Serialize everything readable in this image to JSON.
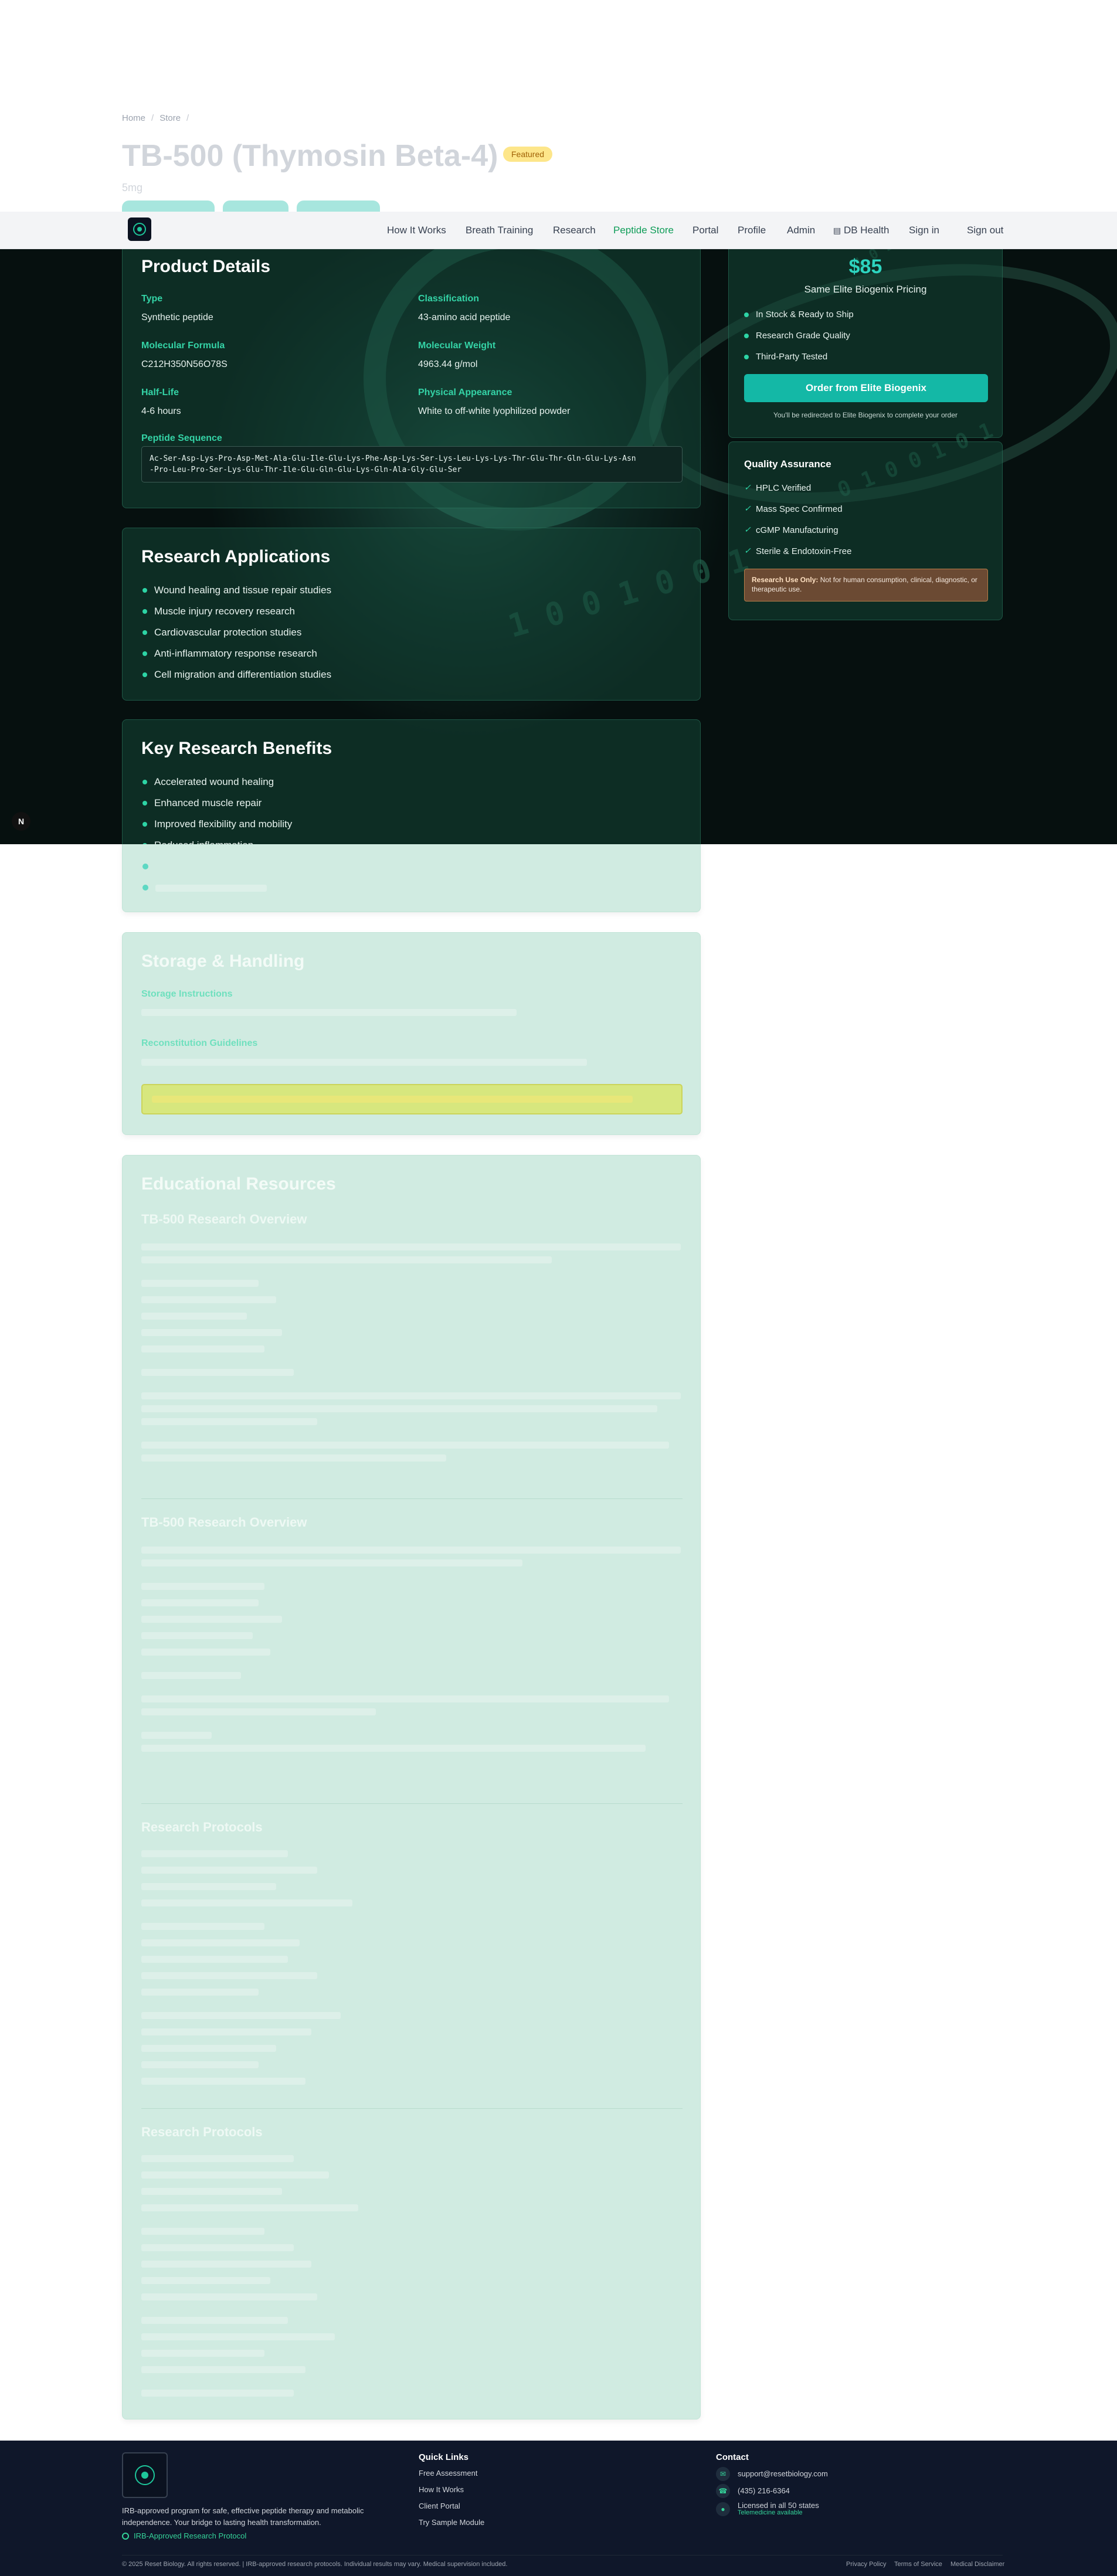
{
  "breadcrumb": {
    "home": "Home",
    "sep": "/",
    "store": "Store",
    "sep2": "/"
  },
  "page": {
    "title": "TB-500 (Thymosin Beta-4)",
    "badge": "Featured",
    "subtitle": "5mg"
  },
  "nav": {
    "items": [
      "How It Works",
      "Breath Training",
      "Research",
      "Peptide Store",
      "Portal",
      "Profile",
      "Admin",
      "DB Health",
      "Sign in",
      "Sign out"
    ],
    "active": "Peptide Store"
  },
  "product_details": {
    "title": "Product Details",
    "type_label": "Type",
    "type_value": "Synthetic peptide",
    "class_label": "Classification",
    "class_value": "43-amino acid peptide",
    "formula_label": "Molecular Formula",
    "formula_value": "C212H350N56O78S",
    "weight_label": "Molecular Weight",
    "weight_value": "4963.44 g/mol",
    "halflife_label": "Half-Life",
    "halflife_value": "4-6 hours",
    "appearance_label": "Physical Appearance",
    "appearance_value": "White to off-white lyophilized powder",
    "sequence_label": "Peptide Sequence",
    "sequence_line1": "Ac-Ser-Asp-Lys-Pro-Asp-Met-Ala-Glu-Ile-Glu-Lys-Phe-Asp-Lys-Ser-Lys-Leu-Lys-Lys-Thr-Glu-Thr-Gln-Glu-Lys-Asn",
    "sequence_line2": "-Pro-Leu-Pro-Ser-Lys-Glu-Thr-Ile-Glu-Gln-Glu-Lys-Gln-Ala-Gly-Glu-Ser"
  },
  "research_applications": {
    "title": "Research Applications",
    "items": [
      "Wound healing and tissue repair studies",
      "Muscle injury recovery research",
      "Cardiovascular protection studies",
      "Anti-inflammatory response research",
      "Cell migration and differentiation studies"
    ]
  },
  "key_benefits": {
    "title": "Key Research Benefits",
    "items": [
      "Accelerated wound healing",
      "Enhanced muscle repair",
      "Improved flexibility and mobility",
      "Reduced inflammation"
    ]
  },
  "storage": {
    "title": "Storage & Handling",
    "storage_label": "Storage Instructions",
    "recon_label": "Reconstitution Guidelines"
  },
  "education": {
    "title": "Educational Resources",
    "overview1": "TB-500 Research Overview",
    "overview2": "TB-500 Research Overview",
    "protocols1": "Research Protocols",
    "protocols2": "Research Protocols"
  },
  "purchase": {
    "price": "$85",
    "price_note": "Same Elite Biogenix Pricing",
    "features": [
      "In Stock & Ready to Ship",
      "Research Grade Quality",
      "Third-Party Tested"
    ],
    "order_button": "Order from Elite Biogenix",
    "redirect_note": "You'll be redirected to Elite Biogenix to complete your order"
  },
  "quality": {
    "title": "Quality Assurance",
    "items": [
      "HPLC Verified",
      "Mass Spec Confirmed",
      "cGMP Manufacturing",
      "Sterile & Endotoxin-Free"
    ],
    "ruo_label": "Research Use Only:",
    "ruo_text": "Not for human consumption, clinical, diagnostic, or therapeutic use."
  },
  "dev_badge": "N",
  "footer": {
    "description": "IRB-approved program for safe, effective peptide therapy and metabolic independence. Your bridge to lasting health transformation.",
    "irb": "IRB-Approved Research Protocol",
    "quick_links_title": "Quick Links",
    "quick_links": [
      "Free Assessment",
      "How It Works",
      "Client Portal",
      "Try Sample Module"
    ],
    "contact_title": "Contact",
    "email": "support@resetbiology.com",
    "phone": "(435) 216-6364",
    "licensed": "Licensed in all 50 states",
    "telemedicine": "Telemedicine available",
    "copyright": "© 2025 Reset Biology. All rights reserved. | IRB-approved research protocols. Individual results may vary. Medical supervision included.",
    "legal": [
      "Privacy Policy",
      "Terms of Service",
      "Medical Disclaimer"
    ]
  },
  "colors": {
    "accent": "#14b8a6",
    "brand_green": "#34d3a6",
    "footer_bg": "#0f172a",
    "hero_bg": "#06100f"
  }
}
